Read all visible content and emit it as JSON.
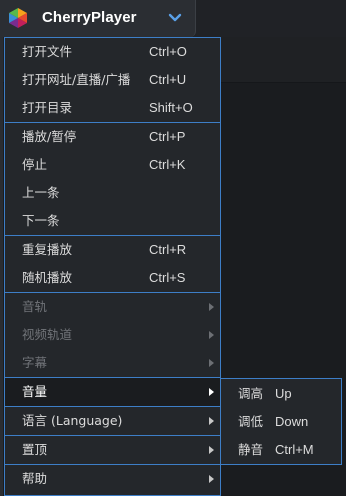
{
  "app": {
    "title": "CherryPlayer"
  },
  "colors": {
    "menu_border": "#3d7ec7",
    "menu_bg": "#24272b",
    "highlight_bg": "#1a1c1f",
    "chevron": "#5aa0e8"
  },
  "menu": {
    "groups": [
      [
        {
          "label": "打开文件",
          "shortcut": "Ctrl+O"
        },
        {
          "label": "打开网址/直播/广播",
          "shortcut": "Ctrl+U"
        },
        {
          "label": "打开目录",
          "shortcut": "Shift+O"
        }
      ],
      [
        {
          "label": "播放/暂停",
          "shortcut": "Ctrl+P"
        },
        {
          "label": "停止",
          "shortcut": "Ctrl+K"
        },
        {
          "label": "上一条",
          "shortcut": ""
        },
        {
          "label": "下一条",
          "shortcut": ""
        }
      ],
      [
        {
          "label": "重复播放",
          "shortcut": "Ctrl+R"
        },
        {
          "label": "随机播放",
          "shortcut": "Ctrl+S"
        }
      ],
      [
        {
          "label": "音轨",
          "submenu": true,
          "disabled": true
        },
        {
          "label": "视频轨道",
          "submenu": true,
          "disabled": true
        },
        {
          "label": "字幕",
          "submenu": true,
          "disabled": true
        }
      ],
      [
        {
          "label": "音量",
          "submenu": true,
          "highlight": true
        }
      ],
      [
        {
          "label": "语言 (Language)",
          "submenu": true
        }
      ],
      [
        {
          "label": "置顶",
          "submenu": true
        }
      ],
      [
        {
          "label": "帮助",
          "submenu": true
        }
      ]
    ]
  },
  "submenu_volume": {
    "items": [
      {
        "label": "调高",
        "shortcut": "Up"
      },
      {
        "label": "调低",
        "shortcut": "Down"
      },
      {
        "label": "静音",
        "shortcut": "Ctrl+M"
      }
    ]
  }
}
